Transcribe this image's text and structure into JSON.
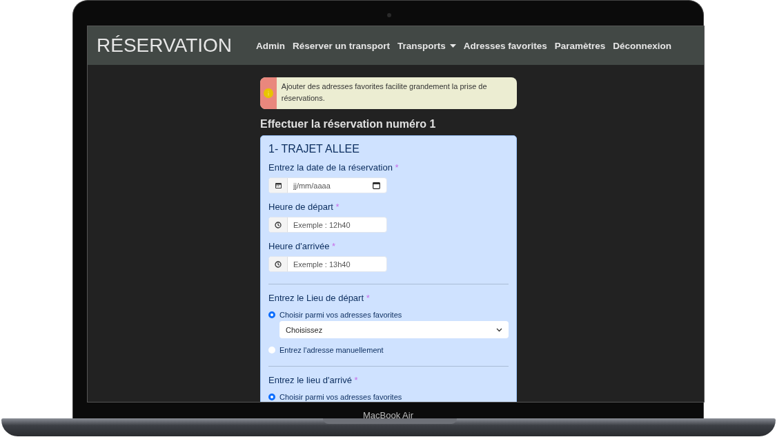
{
  "navbar": {
    "brand": "RÉSERVATION",
    "items": [
      {
        "label": "Admin",
        "dropdown": false
      },
      {
        "label": "Réserver un transport",
        "dropdown": false
      },
      {
        "label": "Transports",
        "dropdown": true
      },
      {
        "label": "Adresses favorites",
        "dropdown": false
      },
      {
        "label": "Paramètres",
        "dropdown": false
      },
      {
        "label": "Déconnexion",
        "dropdown": false
      }
    ]
  },
  "alert": {
    "text": "Ajouter des adresses favorites facilite grandement la prise de réservations."
  },
  "heading": "Effectuer la réservation numéro 1",
  "card": {
    "title": "1- TRAJET ALLEE",
    "fields": [
      {
        "kind": "date",
        "label": "Entrez la date de la réservation",
        "required_mark": "*",
        "placeholder": "jj/mm/aaaa"
      },
      {
        "kind": "time",
        "label": "Heure de départ",
        "required_mark": "*",
        "placeholder": "Exemple : 12h40"
      },
      {
        "kind": "time",
        "label": "Heure d'arrivée",
        "required_mark": "*",
        "placeholder": "Exemple : 13h40"
      },
      {
        "kind": "location",
        "label": "Entrez le Lieu de départ",
        "required_mark": "*",
        "options": [
          {
            "label": "Choisir parmi vos adresses favorites",
            "selected": true,
            "select_value": "Choisissez"
          },
          {
            "label": "Entrez l'adresse manuellement",
            "selected": false
          }
        ]
      },
      {
        "kind": "location",
        "label": "Entrez le lieu d'arrivé",
        "required_mark": "*",
        "options": [
          {
            "label": "Choisir parmi vos adresses favorites",
            "selected": true
          }
        ]
      }
    ]
  },
  "device": {
    "label": "MacBook Air"
  }
}
